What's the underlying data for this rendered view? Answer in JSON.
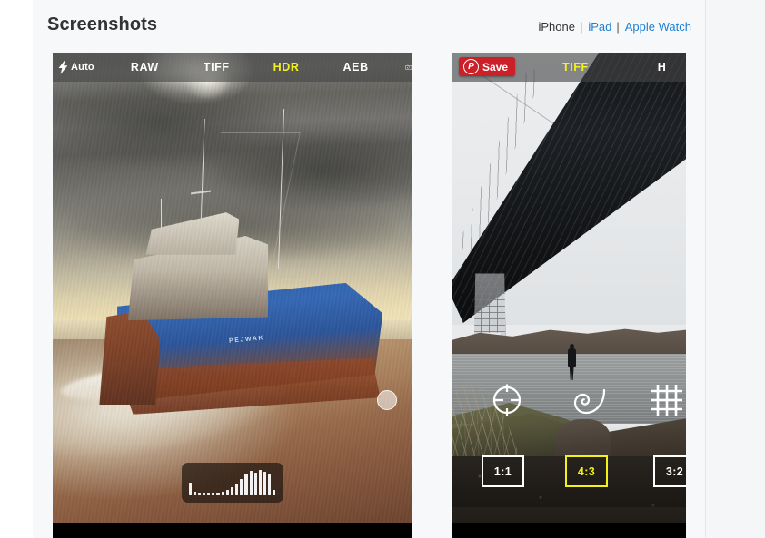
{
  "header": {
    "title": "Screenshots",
    "tabs": [
      {
        "label": "iPhone",
        "active": true
      },
      {
        "label": "iPad",
        "active": false
      },
      {
        "label": "Apple Watch",
        "active": false
      }
    ],
    "separator": "|",
    "link_color": "#1d7fd4"
  },
  "screenshots": [
    {
      "name": "shipwreck-beach-capture",
      "toolbar": {
        "flash_label": "Auto",
        "modes": [
          {
            "label": "RAW",
            "active": false
          },
          {
            "label": "TIFF",
            "active": false
          },
          {
            "label": "HDR",
            "active": true
          },
          {
            "label": "AEB",
            "active": false
          }
        ],
        "flip_icon": "camera-flip-icon",
        "active_color": "#f3f01a"
      },
      "overlays": {
        "histogram_bars": [
          14,
          4,
          3,
          3,
          3,
          3,
          3,
          4,
          6,
          9,
          13,
          18,
          24,
          27,
          25,
          28,
          26,
          24,
          6
        ],
        "focus_ring": true
      },
      "photo_caption_on_hull": "PEJWAK"
    },
    {
      "name": "bridge-river-capture",
      "pinterest": {
        "logo_letter": "P",
        "label": "Save",
        "color": "#cb2027"
      },
      "toolbar": {
        "modes": [
          {
            "label": "TIFF",
            "active": true
          },
          {
            "label": "H",
            "active": false
          }
        ],
        "active_color": "#f3f01a"
      },
      "overlays": {
        "tools": [
          {
            "name": "level-icon"
          },
          {
            "name": "golden-spiral-icon"
          },
          {
            "name": "grid-icon"
          }
        ],
        "aspect_ratios": [
          {
            "label": "1:1",
            "active": false
          },
          {
            "label": "4:3",
            "active": true
          },
          {
            "label": "3:2",
            "active": false
          }
        ]
      }
    }
  ]
}
